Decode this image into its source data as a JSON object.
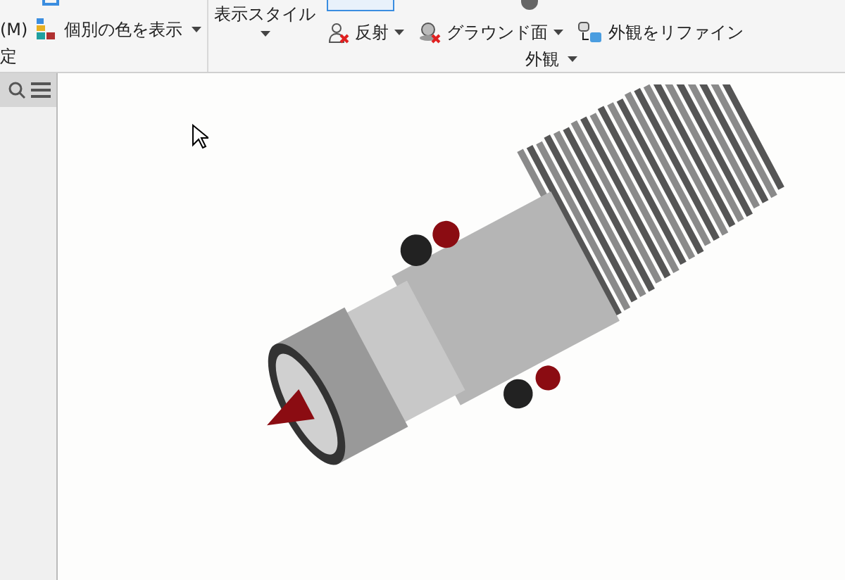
{
  "ribbon": {
    "left_group": {
      "labels": [
        "(M)",
        "定"
      ],
      "color_button": {
        "label": "個別の色を表示",
        "dropdown": true
      }
    },
    "appearance_group": {
      "display_style": {
        "label": "表示スタイル",
        "dropdown": true
      },
      "tools": [
        {
          "kind": "reflection",
          "label": "反射",
          "dropdown": true
        },
        {
          "kind": "ground",
          "label": "グラウンド面",
          "dropdown": true
        },
        {
          "kind": "refine",
          "label": "外観をリファイン",
          "dropdown": false
        }
      ],
      "group_label": {
        "label": "外観",
        "dropdown": true
      }
    }
  }
}
